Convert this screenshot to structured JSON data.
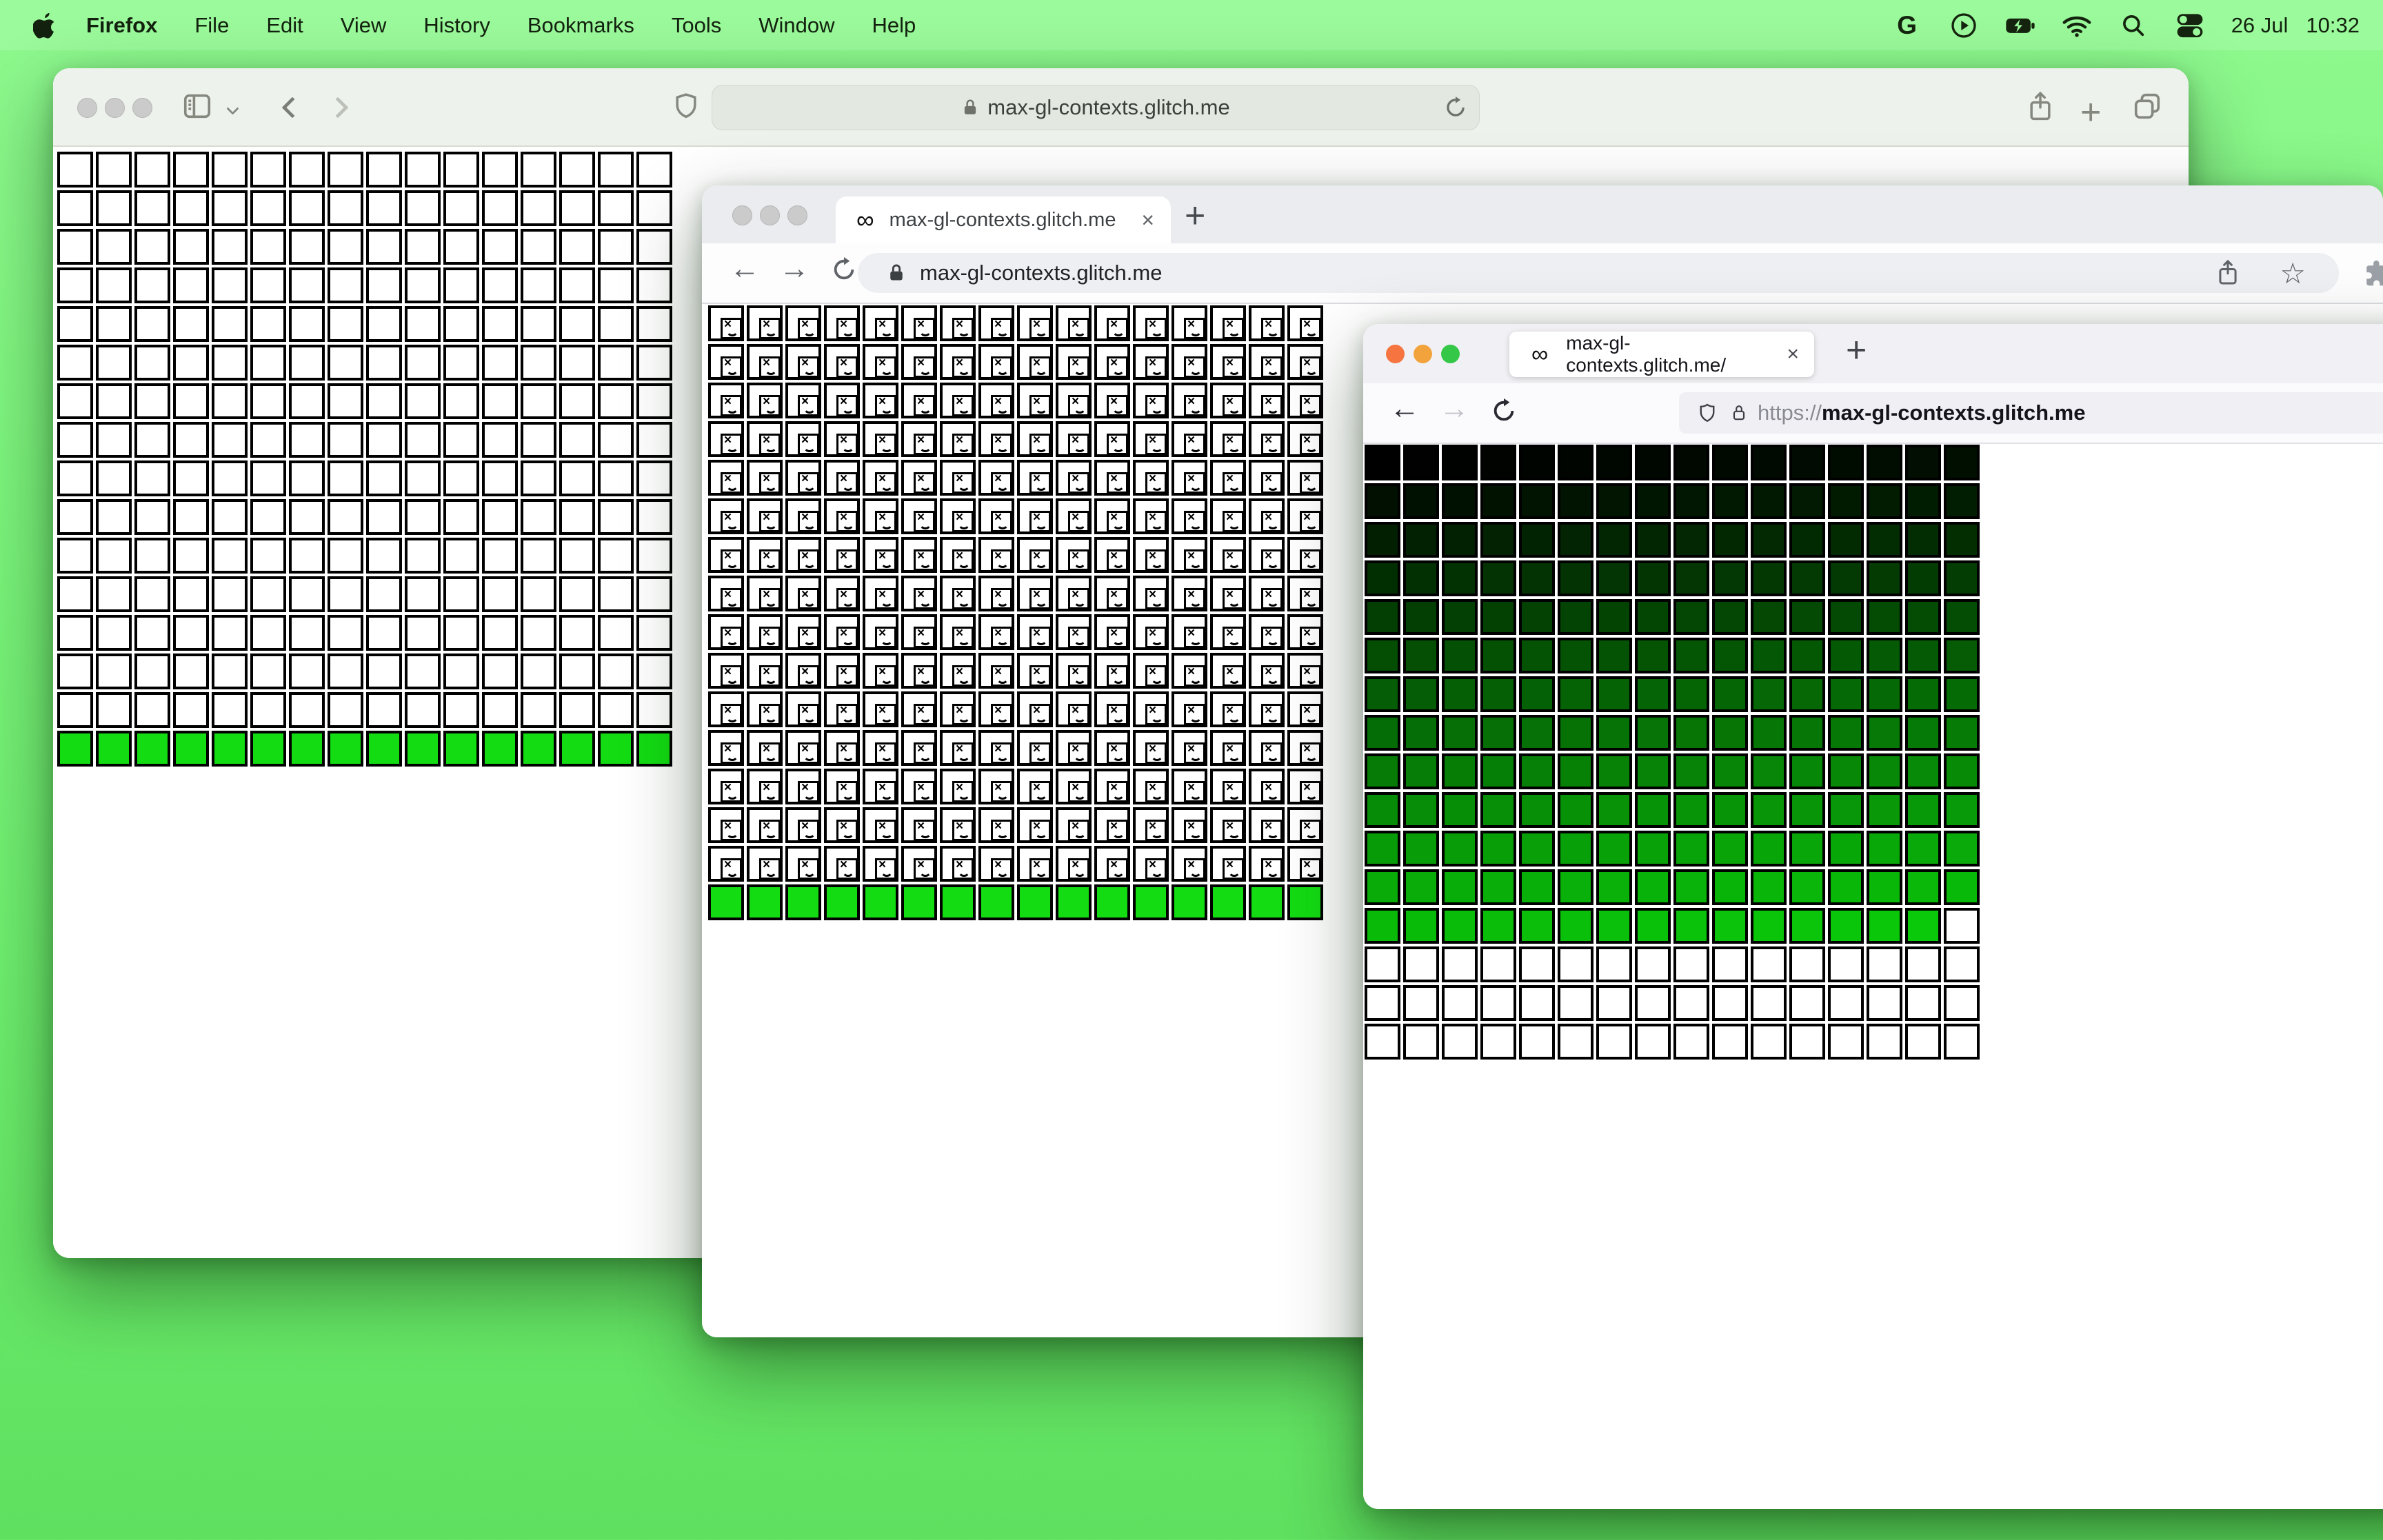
{
  "menu_bar": {
    "items": [
      "Firefox",
      "File",
      "Edit",
      "View",
      "History",
      "Bookmarks",
      "Tools",
      "Window",
      "Help"
    ],
    "active_app_index": 0,
    "status": {
      "date": "26 Jul",
      "time": "10:32"
    },
    "status_icons": [
      "google-g",
      "play-circle",
      "battery-charging",
      "wifi",
      "search",
      "control-center"
    ]
  },
  "safari": {
    "url": "max-gl-contexts.glitch.me",
    "toolbar_icons": [
      "sidebar",
      "back",
      "forward",
      "shield",
      "lock",
      "reload",
      "share",
      "new-tab",
      "tab-overview"
    ]
  },
  "chrome": {
    "tab_title": "max-gl-contexts.glitch.me",
    "tab_favicon": "∞",
    "close_glyph": "×",
    "plus_glyph": "+",
    "url": "max-gl-contexts.glitch.me",
    "nav_back": "←",
    "nav_forward": "→",
    "star_glyph": "☆"
  },
  "firefox": {
    "tab_title": "max-gl-contexts.glitch.me/",
    "tab_favicon": "∞",
    "close_glyph": "×",
    "plus_glyph": "+",
    "url_prefix": "https://",
    "url_domain": "max-gl-contexts.glitch.me",
    "nav_back": "←",
    "nav_forward": "→"
  },
  "grids": {
    "cols": 16,
    "rows": 16,
    "safari": {
      "white_rows": 15,
      "green_rows": 1,
      "green_color": "#13dc13",
      "broken_icon": false
    },
    "chrome": {
      "white_rows": 15,
      "green_rows": 1,
      "green_color": "#13dc13",
      "broken_icon": true
    },
    "firefox": {
      "colored_cells": 207,
      "gradient_green_max": 200,
      "white_color": "#ffffff"
    }
  }
}
